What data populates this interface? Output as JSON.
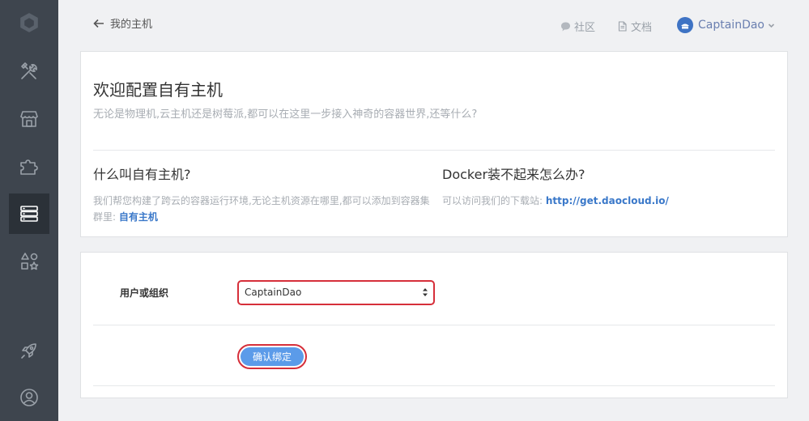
{
  "sidebar": {
    "items": [
      {
        "name": "logo-icon",
        "active": false
      },
      {
        "name": "tools-icon",
        "active": false
      },
      {
        "name": "store-icon",
        "active": false
      },
      {
        "name": "puzzle-icon",
        "active": false
      },
      {
        "name": "server-icon",
        "active": true
      },
      {
        "name": "shapes-icon",
        "active": false
      },
      {
        "name": "rocket-icon",
        "active": false
      },
      {
        "name": "user-icon",
        "active": false
      }
    ]
  },
  "header": {
    "back_label": "我的主机",
    "community_label": "社区",
    "docs_label": "文档",
    "username": "CaptainDao"
  },
  "welcome": {
    "title": "欢迎配置自有主机",
    "subtitle": "无论是物理机,云主机还是树莓派,都可以在这里一步接入神奇的容器世界,还等什么?"
  },
  "faq": {
    "left": {
      "title": "什么叫自有主机?",
      "body": "我们帮您构建了跨云的容器运行环境,无论主机资源在哪里,都可以添加到容器集群里: ",
      "link": "自有主机"
    },
    "right": {
      "title": "Docker装不起来怎么办?",
      "body": "可以访问我们的下载站: ",
      "link": "http://get.daocloud.io/"
    }
  },
  "form": {
    "owner_label": "用户或组织",
    "owner_value": "CaptainDao",
    "confirm_label": "确认绑定"
  },
  "colors": {
    "sidebar_bg": "#3e454e",
    "accent": "#5b9be9",
    "link": "#3a78c9",
    "highlight_border": "#d62f3a"
  }
}
